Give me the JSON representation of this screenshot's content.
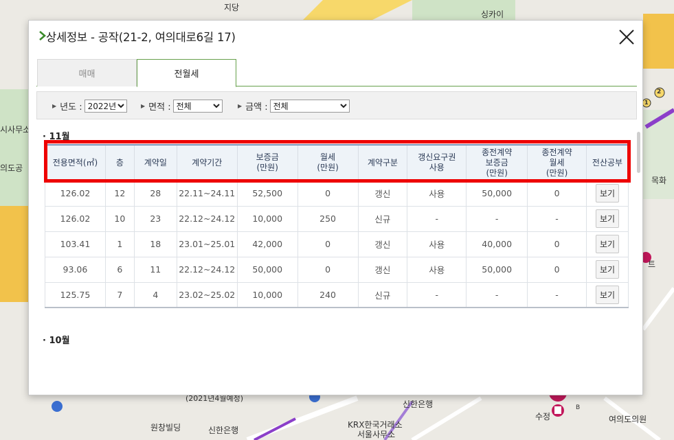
{
  "map": {
    "labels": {
      "sidang": "지당",
      "sinkai": "싱카이",
      "sa_office": "시사무소",
      "park": "의도공",
      "mokhwa": "목화",
      "shinhan_bank_1": "신한은행",
      "krx": "KRX한국거래소",
      "krx_office": "서울사무소",
      "wonchang": "원창빌딩",
      "shinhan_bank_2": "신한은행",
      "sujeong": "수정",
      "clinic": "여의도의원",
      "road_text": "(2021년4월예정)",
      "marker_b": "B",
      "marker_t": "트",
      "subway_num": "2",
      "subway_num_1": "1"
    }
  },
  "modal": {
    "title": "상세정보 - 공작(21-2, 여의대로6길 17)",
    "tabs": {
      "sale": "매매",
      "rent": "전월세"
    },
    "filters": {
      "year_label": "년도 :",
      "year_value": "2022년",
      "area_label": "면적 :",
      "area_value": "전체",
      "price_label": "금액 :",
      "price_value": "전체"
    },
    "sections": {
      "november": "11월",
      "october": "10월"
    },
    "table": {
      "headers": {
        "area": "전용면적(㎡)",
        "floor": "층",
        "contract_day": "계약일",
        "period": "계약기간",
        "deposit": [
          "보증금",
          "(만원)"
        ],
        "monthly": [
          "월세",
          "(만원)"
        ],
        "type": "계약구분",
        "renewal_right": [
          "갱신요구권",
          "사용"
        ],
        "prev_deposit": [
          "종전계약",
          "보증금",
          "(만원)"
        ],
        "prev_monthly": [
          "종전계약",
          "월세",
          "(만원)"
        ],
        "registry": "전산공부"
      },
      "rows": [
        [
          "126.02",
          "12",
          "28",
          "22.11~24.11",
          "52,500",
          "0",
          "갱신",
          "사용",
          "50,000",
          "0"
        ],
        [
          "126.02",
          "10",
          "23",
          "22.12~24.12",
          "10,000",
          "250",
          "신규",
          "-",
          "-",
          "-"
        ],
        [
          "103.41",
          "1",
          "18",
          "23.01~25.01",
          "42,000",
          "0",
          "갱신",
          "사용",
          "40,000",
          "0"
        ],
        [
          "93.06",
          "6",
          "11",
          "22.12~24.12",
          "50,000",
          "0",
          "갱신",
          "사용",
          "50,000",
          "0"
        ],
        [
          "125.75",
          "7",
          "4",
          "23.02~25.02",
          "10,000",
          "240",
          "신규",
          "-",
          "-",
          "-"
        ]
      ],
      "view_label": "보기"
    }
  },
  "colors": {
    "accent_green": "#66a04a",
    "highlight_red": "#ee0000",
    "header_bg": "#eef3f8"
  }
}
